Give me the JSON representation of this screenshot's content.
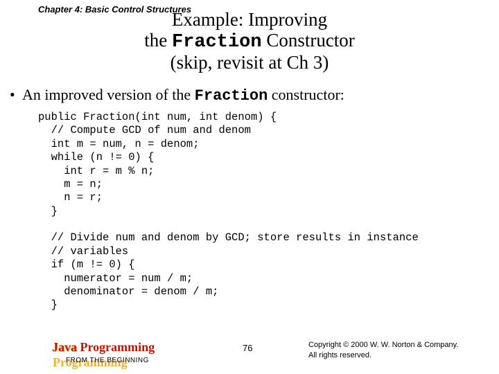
{
  "chapter": "Chapter 4: Basic Control Structures",
  "title": {
    "line1_pre": "Example: Improving",
    "line2_pre": "the ",
    "line2_mono": "Fraction",
    "line2_post": " Constructor",
    "line3": "(skip, revisit at Ch 3)"
  },
  "bullet": {
    "pre": "An improved version of the ",
    "mono": "Fraction",
    "post": " constructor:"
  },
  "code": "public Fraction(int num, int denom) {\n  // Compute GCD of num and denom\n  int m = num, n = denom;\n  while (n != 0) {\n    int r = m % n;\n    m = n;\n    n = r;\n  }\n\n  // Divide num and denom by GCD; store results in instance \n  // variables\n  if (m != 0) {\n    numerator = num / m;\n    denominator = denom / m;\n  }",
  "footer": {
    "book_title": "Java Programming",
    "book_sub": "FROM THE BEGINNING",
    "page": "76",
    "copyright_l1": "Copyright © 2000 W. W. Norton & Company.",
    "copyright_l2": "All rights reserved."
  }
}
